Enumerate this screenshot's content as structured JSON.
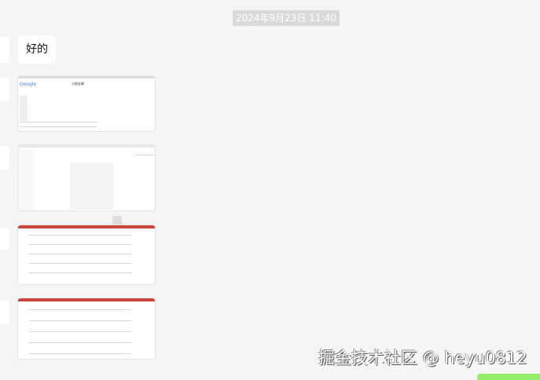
{
  "timestamp": "2024年9月23日 11:40",
  "messages": [
    {
      "type": "text",
      "text": "好的"
    },
    {
      "type": "image",
      "desc": "google-page"
    },
    {
      "type": "image",
      "desc": "browser-page"
    },
    {
      "type": "image",
      "desc": "table-page"
    },
    {
      "type": "image",
      "desc": "table-page"
    }
  ],
  "thumb1": {
    "logo": "Google",
    "title": "与朋友聊"
  },
  "watermark": "掘金技术社区 @ heyu0812",
  "colors": {
    "background": "#f5f5f5",
    "accent": "#95ec69",
    "table_header": "#c9463d"
  }
}
